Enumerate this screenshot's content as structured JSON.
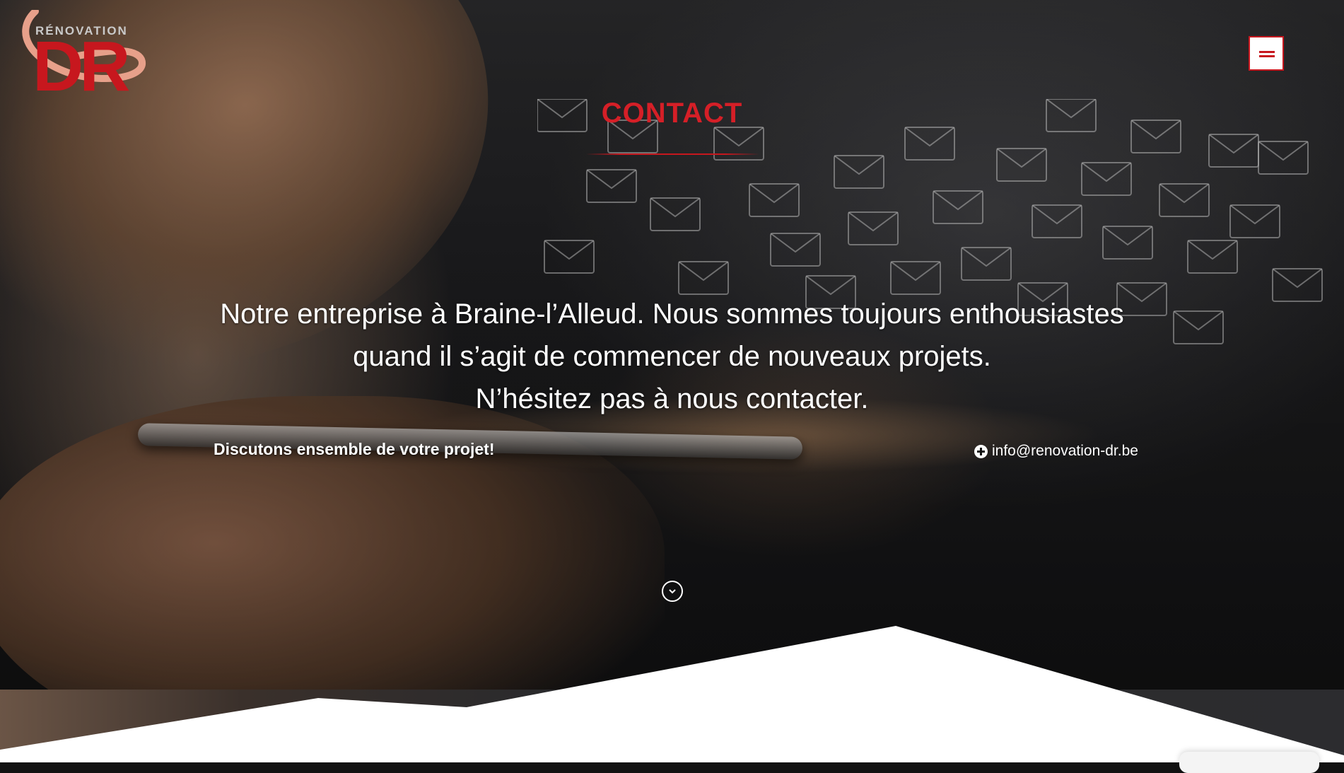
{
  "brand": {
    "logo_top_text": "RÉNOVATION",
    "logo_main_text": "DR",
    "accent_color": "#c7171e"
  },
  "header": {
    "menu_icon": "hamburger-menu-icon"
  },
  "hero": {
    "title": "CONTACT",
    "lead_lines": [
      "Notre entreprise à Braine-l’Alleud. Nous sommes toujours enthousiastes",
      "quand il s’agit de commencer de nouveaux projets.",
      "N’hésitez pas à nous contacter."
    ],
    "subheading": "Discutons ensemble de votre projet!",
    "email": "info@renovation-dr.be",
    "email_icon": "plus-circle-icon",
    "scroll_icon": "chevron-down-circle-icon"
  }
}
